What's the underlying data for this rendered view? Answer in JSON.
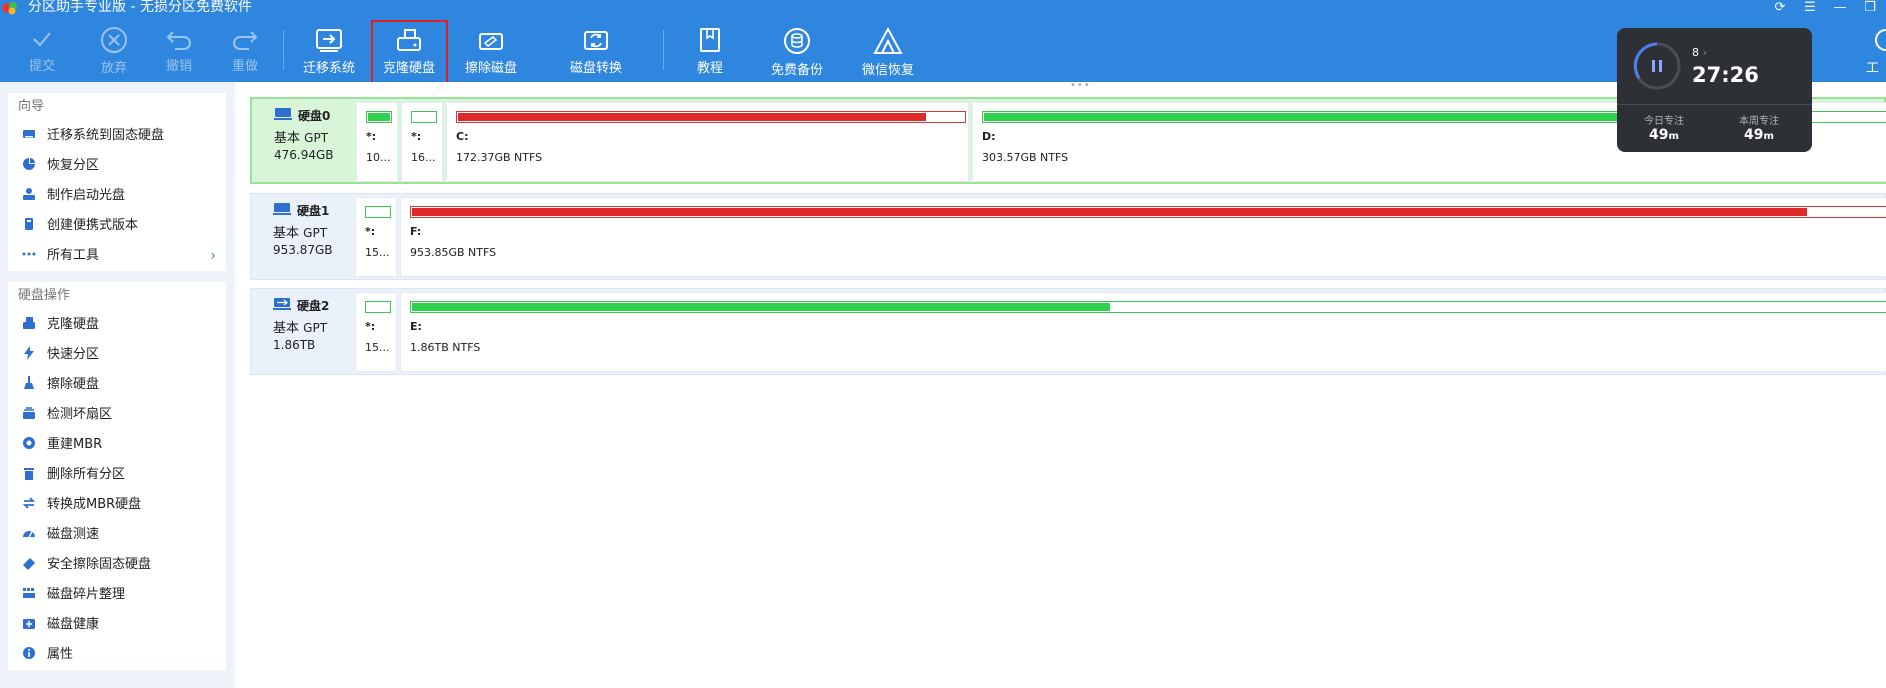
{
  "app": {
    "title": "分区助手专业版 - 无损分区免费软件"
  },
  "toolbar": {
    "buttons": [
      {
        "label": "提交",
        "icon": "check-icon"
      },
      {
        "label": "放弃",
        "icon": "discard-icon"
      },
      {
        "label": "撤销",
        "icon": "undo-icon"
      },
      {
        "label": "重做",
        "icon": "redo-icon"
      },
      {
        "label": "迁移系统",
        "icon": "migrate-system-icon"
      },
      {
        "label": "克隆硬盘",
        "icon": "clone-disk-icon"
      },
      {
        "label": "擦除磁盘",
        "icon": "wipe-disk-icon"
      },
      {
        "label": "磁盘转换",
        "icon": "disk-convert-icon"
      },
      {
        "label": "教程",
        "icon": "tutorial-icon"
      },
      {
        "label": "免费备份",
        "icon": "free-backup-icon"
      },
      {
        "label": "微信恢复",
        "icon": "wechat-recovery-icon"
      },
      {
        "label": "工",
        "icon": "tools-icon"
      }
    ]
  },
  "sidebar": {
    "wizard_title": "向导",
    "wizard_items": [
      {
        "label": "迁移系统到固态硬盘"
      },
      {
        "label": "恢复分区"
      },
      {
        "label": "制作启动光盘"
      },
      {
        "label": "创建便携式版本"
      },
      {
        "label": "所有工具"
      }
    ],
    "diskops_title": "硬盘操作",
    "diskops_items": [
      {
        "label": "克隆硬盘"
      },
      {
        "label": "快速分区"
      },
      {
        "label": "擦除硬盘"
      },
      {
        "label": "检测坏扇区"
      },
      {
        "label": "重建MBR"
      },
      {
        "label": "删除所有分区"
      },
      {
        "label": "转换成MBR硬盘"
      },
      {
        "label": "磁盘测速"
      },
      {
        "label": "安全擦除固态硬盘"
      },
      {
        "label": "磁盘碎片整理"
      },
      {
        "label": "磁盘健康"
      },
      {
        "label": "属性"
      }
    ]
  },
  "disks": [
    {
      "name": "硬盘0",
      "type": "基本",
      "scheme": "GPT",
      "size": "476.94GB",
      "partitions": [
        {
          "label": "*:",
          "info": "10...",
          "used_fraction": 0.9,
          "color": "green"
        },
        {
          "label": "*:",
          "info": "16...",
          "used_fraction": 0.0,
          "color": "green"
        },
        {
          "label": "C:",
          "info": "172.37GB NTFS",
          "used_fraction": 0.92,
          "color": "red"
        },
        {
          "label": "D:",
          "info": "303.57GB NTFS",
          "used_fraction": 0.7,
          "color": "green"
        }
      ]
    },
    {
      "name": "硬盘1",
      "type": "基本",
      "scheme": "GPT",
      "size": "953.87GB",
      "partitions": [
        {
          "label": "*:",
          "info": "15...",
          "used_fraction": 0.0,
          "color": "green"
        },
        {
          "label": "F:",
          "info": "953.85GB NTFS",
          "used_fraction": 0.95,
          "color": "red"
        }
      ]
    },
    {
      "name": "硬盘2",
      "type": "基本",
      "scheme": "GPT",
      "size": "1.86TB",
      "partitions": [
        {
          "label": "*:",
          "info": "15...",
          "used_fraction": 0.0,
          "color": "green"
        },
        {
          "label": "E:",
          "info": "1.86TB NTFS",
          "used_fraction": 0.47,
          "color": "green"
        }
      ]
    }
  ],
  "timer": {
    "count": "8",
    "time": "27:26",
    "today_label": "今日专注",
    "today_value": "49",
    "week_label": "本周专注",
    "week_value": "49",
    "unit": "m"
  },
  "colors": {
    "toolbar": "#2f86de",
    "used_red": "#de2a2a",
    "used_green": "#2fd24c",
    "selected_row": "#d9f5d8"
  }
}
